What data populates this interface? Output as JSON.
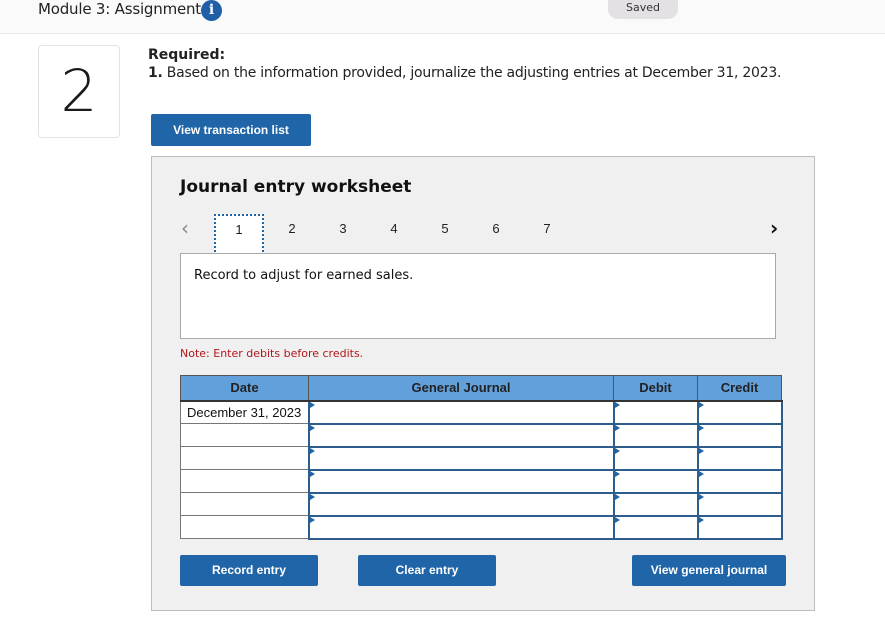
{
  "header": {
    "module_title": "Module 3: Assignment",
    "info_icon": "info-icon",
    "saved_label": "Saved"
  },
  "question": {
    "number": "2",
    "required_label": "Required:",
    "item_number": "1.",
    "item_text": " Based on the information provided, journalize the adjusting entries at December 31, 2023."
  },
  "buttons": {
    "view_transaction_list": "View transaction list",
    "record_entry": "Record entry",
    "clear_entry": "Clear entry",
    "view_general_journal": "View general journal"
  },
  "worksheet": {
    "title": "Journal entry worksheet",
    "prev_icon": "‹",
    "next_icon": "›",
    "pages": [
      "1",
      "2",
      "3",
      "4",
      "5",
      "6",
      "7"
    ],
    "active_page": "1",
    "description": "Record to adjust for earned sales.",
    "note": "Note: Enter debits before credits."
  },
  "journal": {
    "columns": [
      "Date",
      "General Journal",
      "Debit",
      "Credit"
    ],
    "rows": [
      {
        "date": "December 31, 2023",
        "account": "",
        "debit": "",
        "credit": ""
      },
      {
        "date": "",
        "account": "",
        "debit": "",
        "credit": ""
      },
      {
        "date": "",
        "account": "",
        "debit": "",
        "credit": ""
      },
      {
        "date": "",
        "account": "",
        "debit": "",
        "credit": ""
      },
      {
        "date": "",
        "account": "",
        "debit": "",
        "credit": ""
      },
      {
        "date": "",
        "account": "",
        "debit": "",
        "credit": ""
      }
    ]
  },
  "colors": {
    "primary_button": "#2065a8",
    "table_header": "#62a0dc",
    "note_text": "#b1171b",
    "panel_bg": "#f0f0f0"
  }
}
